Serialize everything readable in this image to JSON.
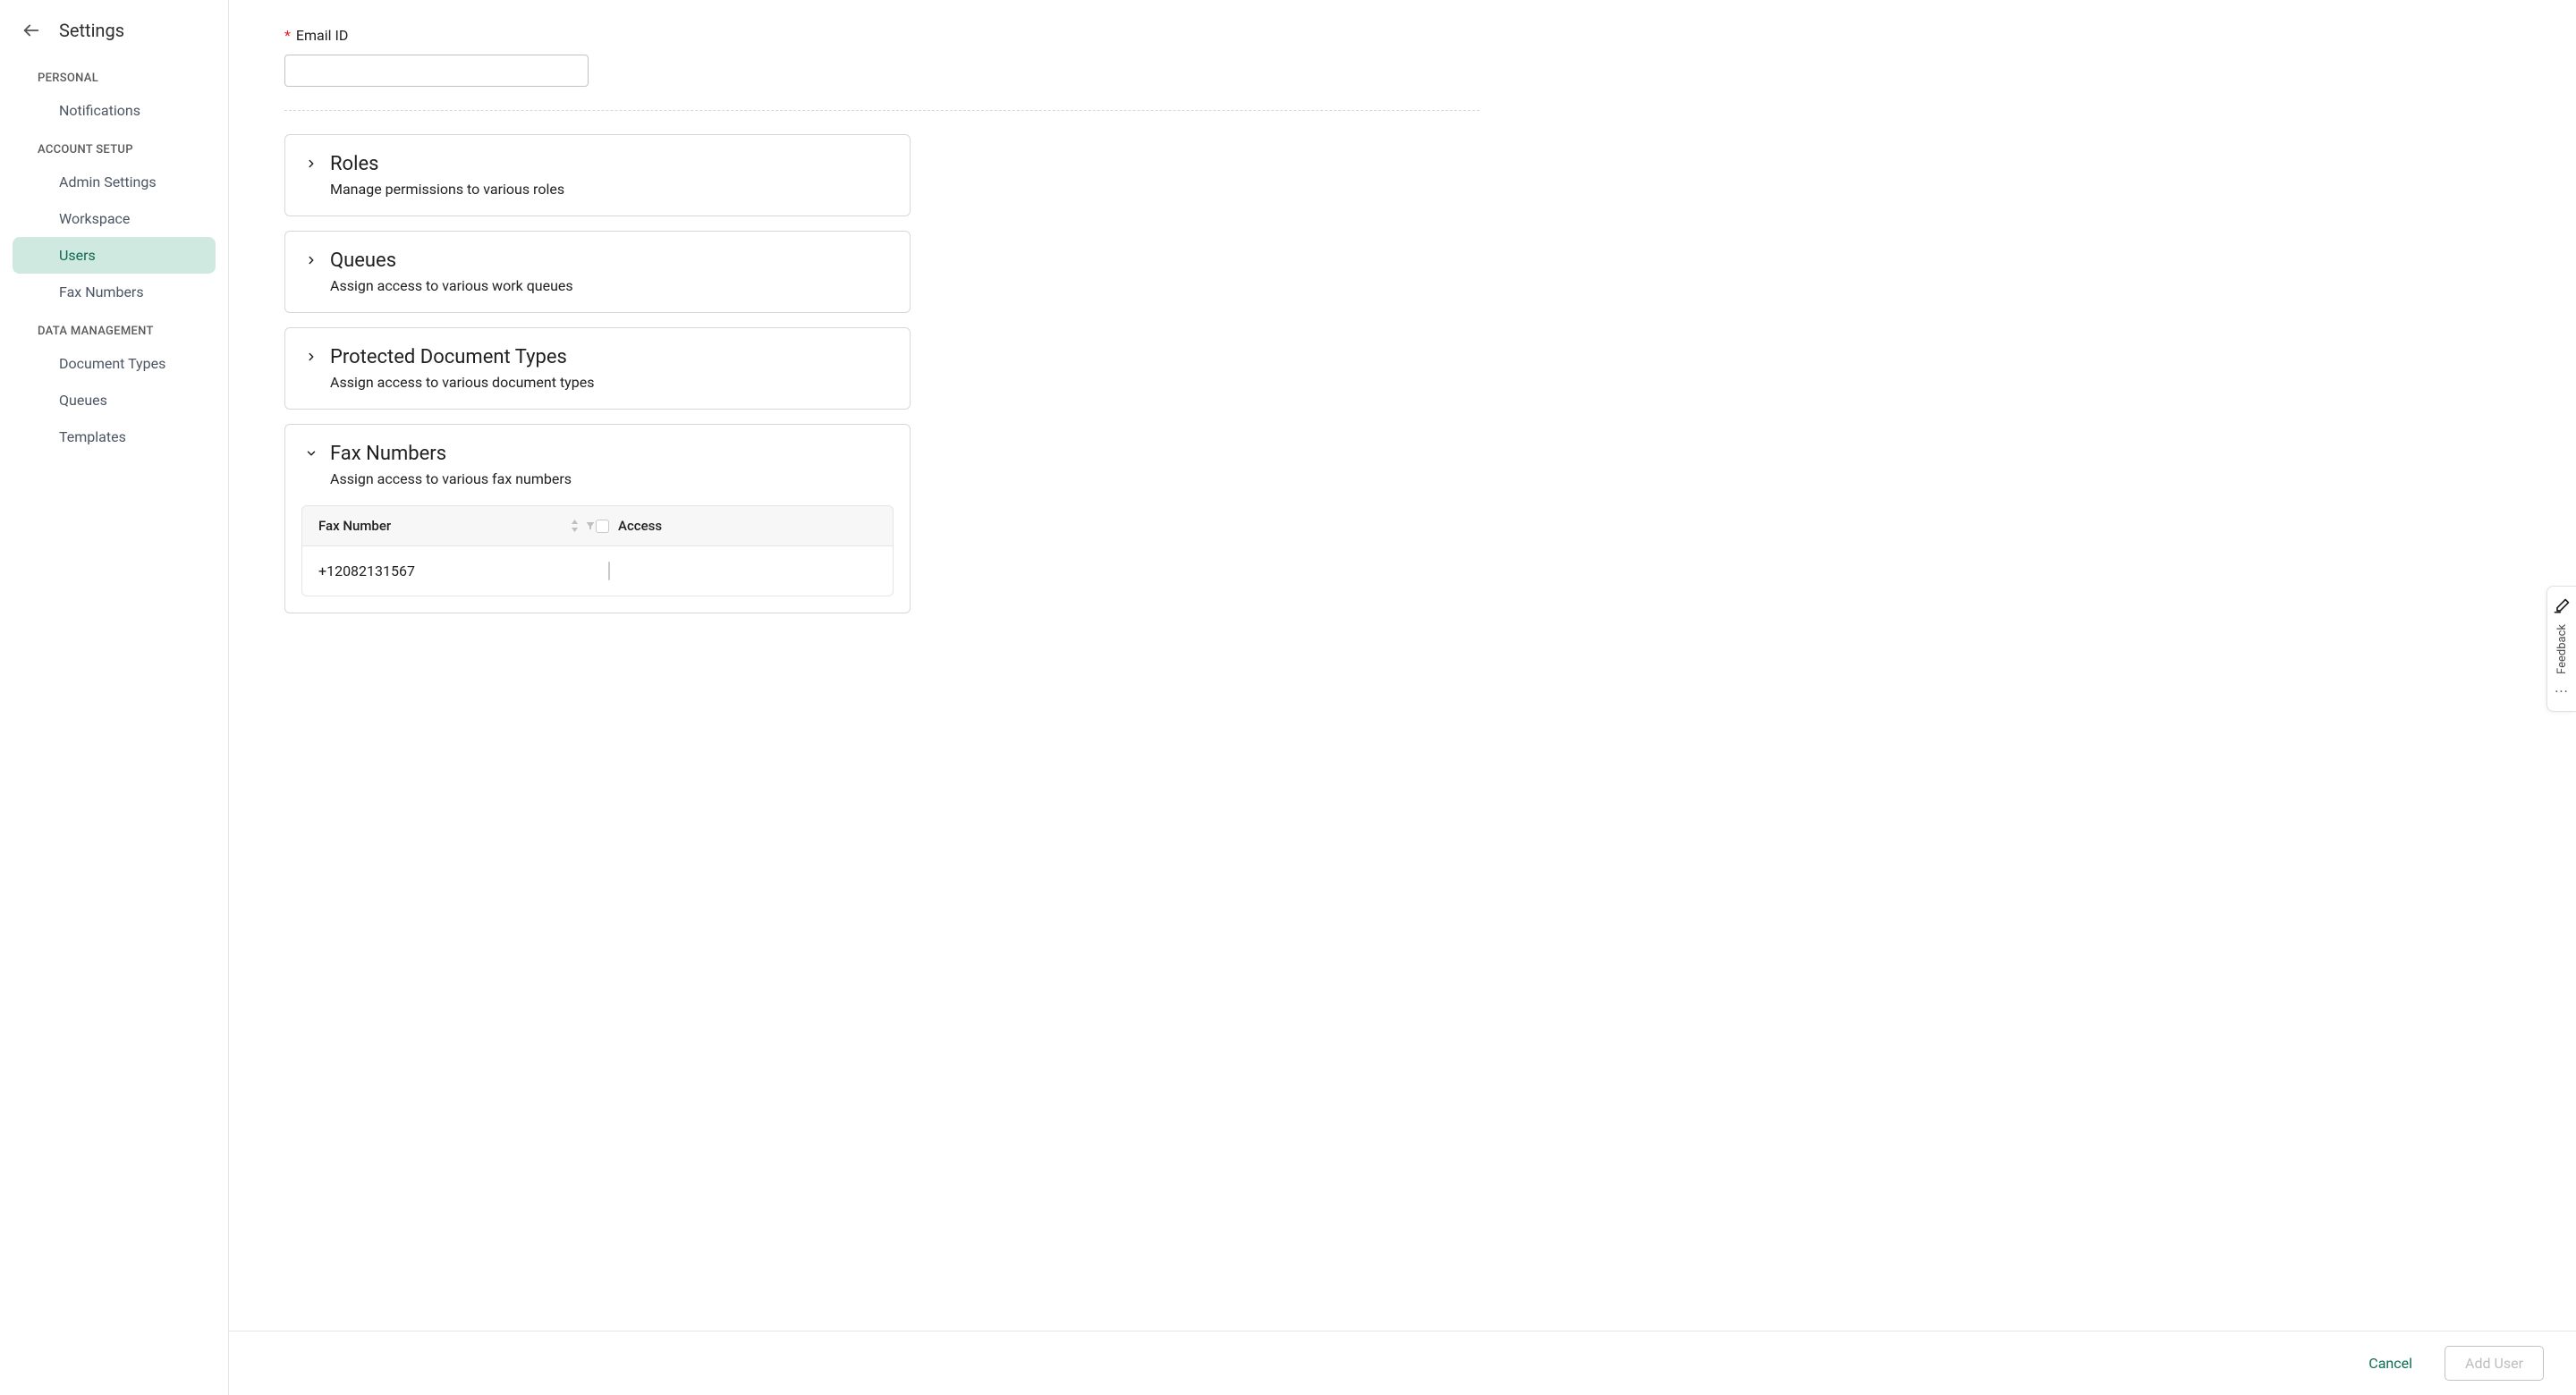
{
  "sidebar": {
    "title": "Settings",
    "sections": [
      {
        "label": "PERSONAL",
        "items": [
          {
            "label": "Notifications",
            "active": false
          }
        ]
      },
      {
        "label": "ACCOUNT SETUP",
        "items": [
          {
            "label": "Admin Settings",
            "active": false
          },
          {
            "label": "Workspace",
            "active": false
          },
          {
            "label": "Users",
            "active": true
          },
          {
            "label": "Fax Numbers",
            "active": false
          }
        ]
      },
      {
        "label": "DATA MANAGEMENT",
        "items": [
          {
            "label": "Document Types",
            "active": false
          },
          {
            "label": "Queues",
            "active": false
          },
          {
            "label": "Templates",
            "active": false
          }
        ]
      }
    ]
  },
  "form": {
    "email_label": "Email ID",
    "email_value": ""
  },
  "panels": [
    {
      "title": "Roles",
      "sub": "Manage permissions to various roles",
      "expanded": false
    },
    {
      "title": "Queues",
      "sub": "Assign access to various work queues",
      "expanded": false
    },
    {
      "title": "Protected Document Types",
      "sub": "Assign access to various document types",
      "expanded": false
    },
    {
      "title": "Fax Numbers",
      "sub": "Assign access to various fax numbers",
      "expanded": true
    }
  ],
  "fax_table": {
    "col_number": "Fax Number",
    "col_access": "Access",
    "rows": [
      {
        "number": "+12082131567",
        "access": false
      }
    ]
  },
  "footer": {
    "cancel": "Cancel",
    "add": "Add User"
  },
  "feedback": {
    "label": "Feedback"
  }
}
